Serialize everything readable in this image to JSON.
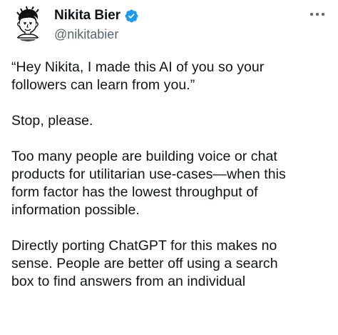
{
  "author": {
    "display_name": "Nikita Bier",
    "handle": "@nikitabier",
    "verified": true,
    "verified_color": "#1d9bf0",
    "avatar_icon": "cartoon-portrait-avatar"
  },
  "menu": {
    "more_icon": "more-horizontal-icon"
  },
  "tweet": {
    "paragraphs": [
      {
        "lines": [
          "“Hey Nikita, I made this AI of you so your",
          "followers can learn from you.”"
        ]
      },
      {
        "lines": [
          "Stop, please."
        ]
      },
      {
        "lines": [
          "Too many people are building voice or chat",
          "products for utilitarian use-cases—when this",
          "form factor has the lowest throughput of",
          "information possible."
        ]
      },
      {
        "lines": [
          "Directly porting ChatGPT for this makes no",
          "sense. People are better off using a search",
          "box to find answers from an individual"
        ]
      }
    ]
  }
}
